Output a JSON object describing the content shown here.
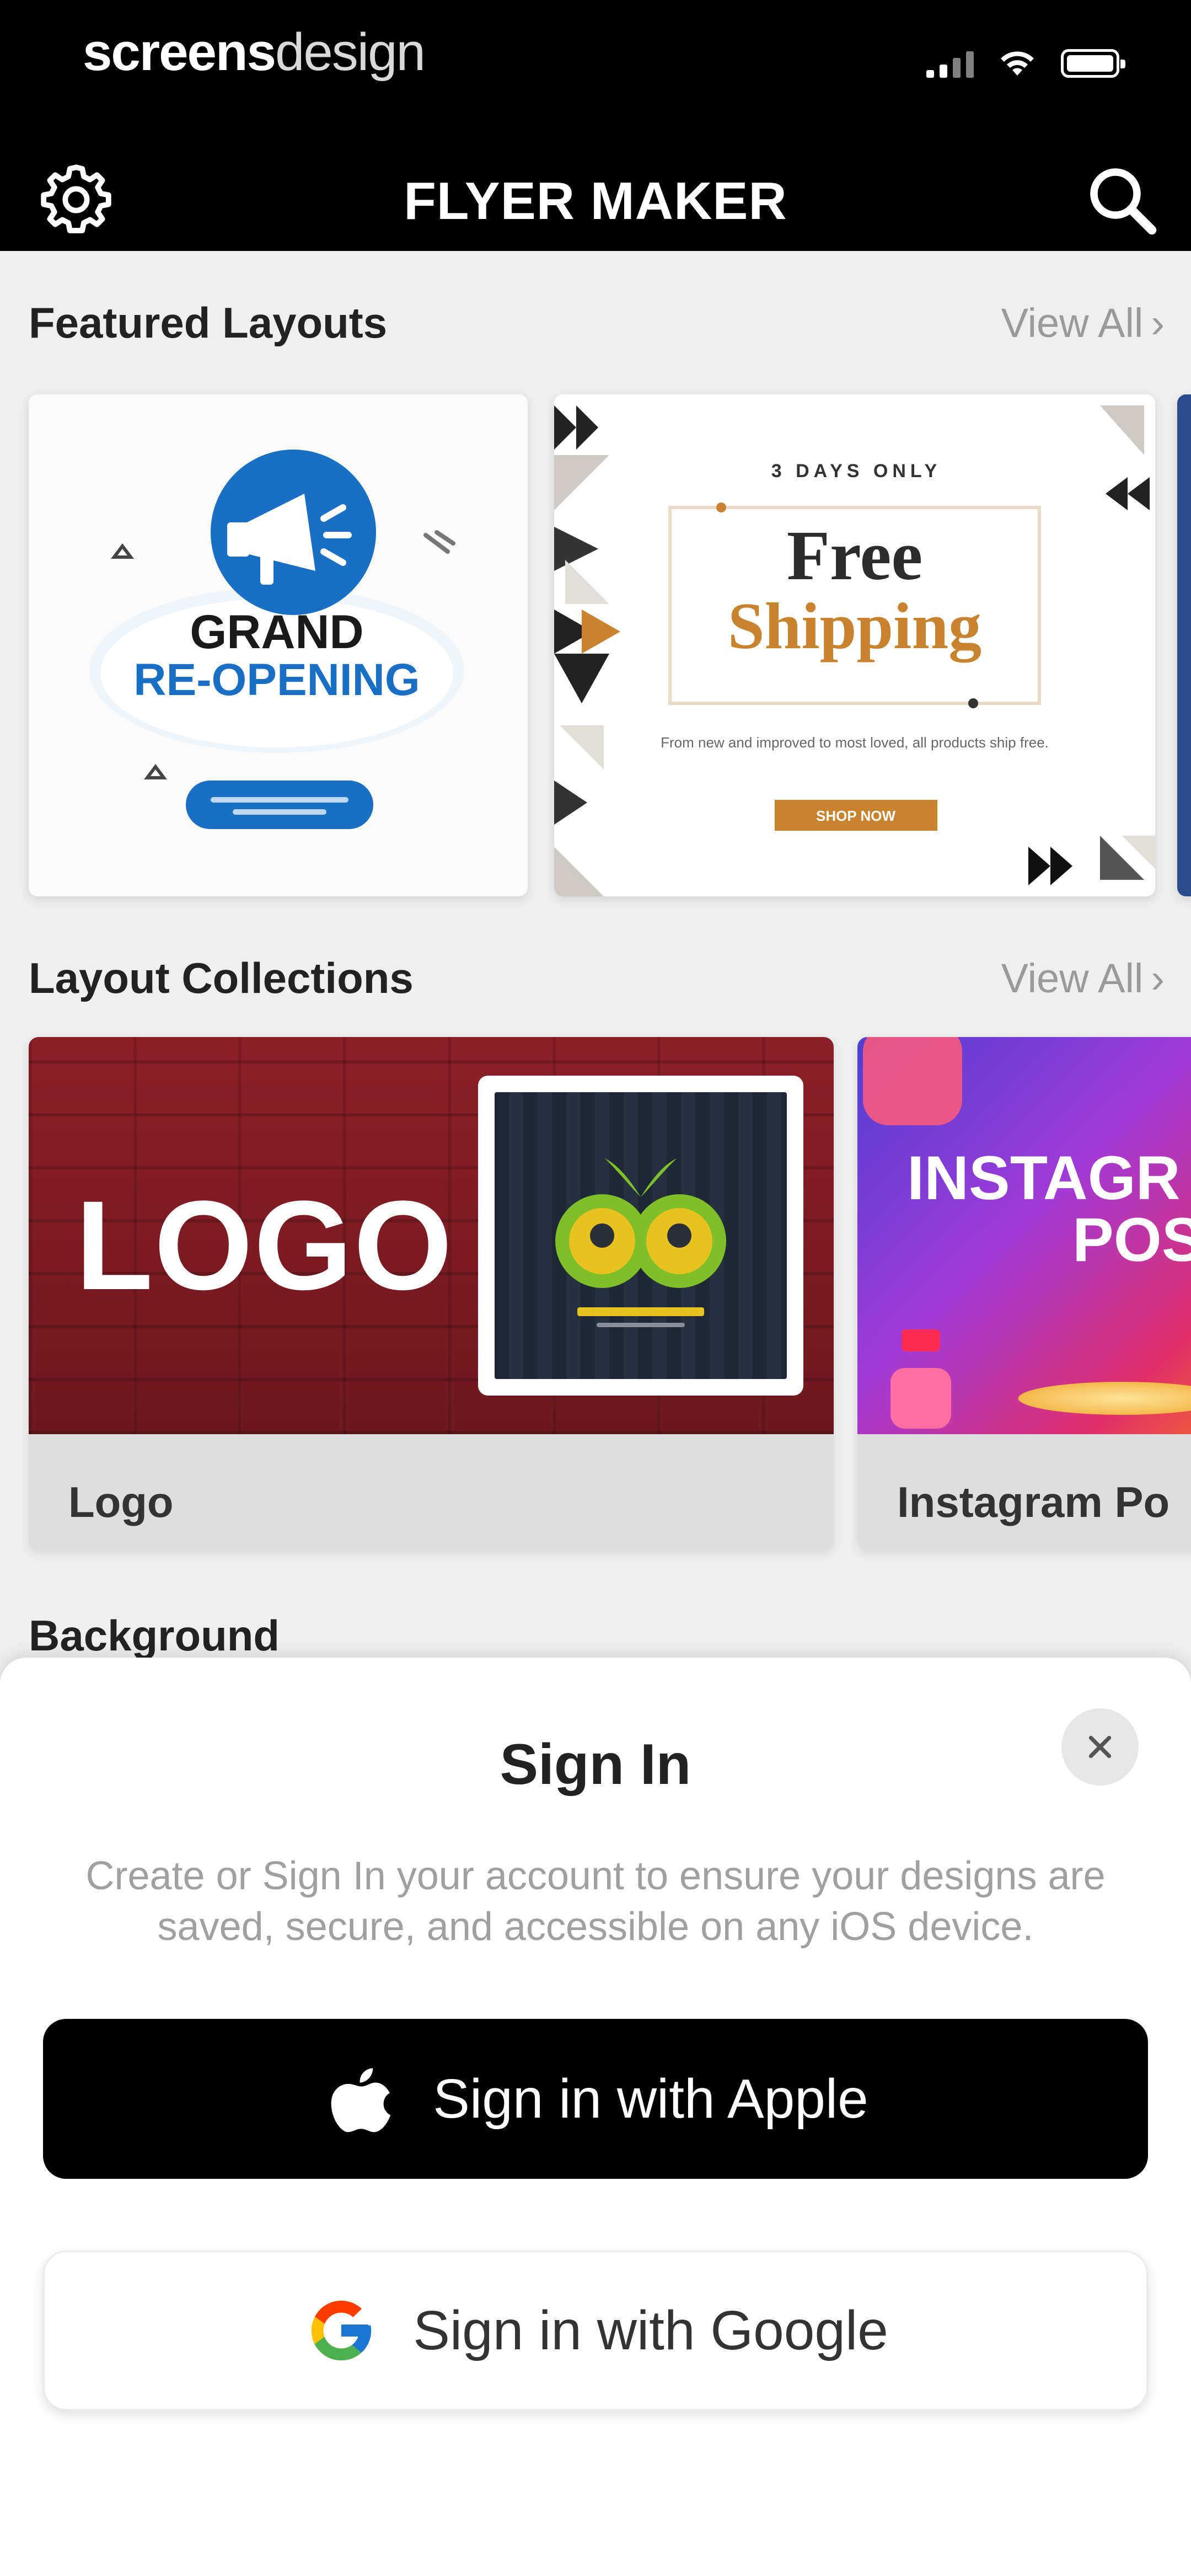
{
  "status_bar": {
    "brand_bold": "screens",
    "brand_light": "design"
  },
  "nav": {
    "title": "FLYER MAKER",
    "left_icon": "gear-icon",
    "right_icon": "search-icon"
  },
  "featured": {
    "title": "Featured Layouts",
    "view_all": "View All",
    "cards": [
      {
        "line1": "GRAND",
        "line2": "RE-OPENING"
      },
      {
        "tag": "3 DAYS ONLY",
        "line1": "Free",
        "line2": "Shipping",
        "subtitle": "From new and improved to most loved, all products ship free.",
        "button": "SHOP NOW"
      }
    ]
  },
  "collections": {
    "title": "Layout Collections",
    "view_all": "View All",
    "items": [
      {
        "image_text": "LOGO",
        "label": "Logo"
      },
      {
        "image_text_1": "INSTAGR",
        "image_text_2": "POST",
        "label": "Instagram Po"
      }
    ]
  },
  "background_section": {
    "title": "Background"
  },
  "signin": {
    "title": "Sign In",
    "description": "Create or Sign In your account to ensure your designs are saved, secure, and accessible on any iOS device.",
    "apple_label": "Sign in with Apple",
    "google_label": "Sign in with Google"
  },
  "colors": {
    "header": "#000000",
    "page": "#efefef",
    "accent_blue": "#1a6fc4",
    "accent_gold": "#c8832f",
    "apple_button": "#000000"
  }
}
